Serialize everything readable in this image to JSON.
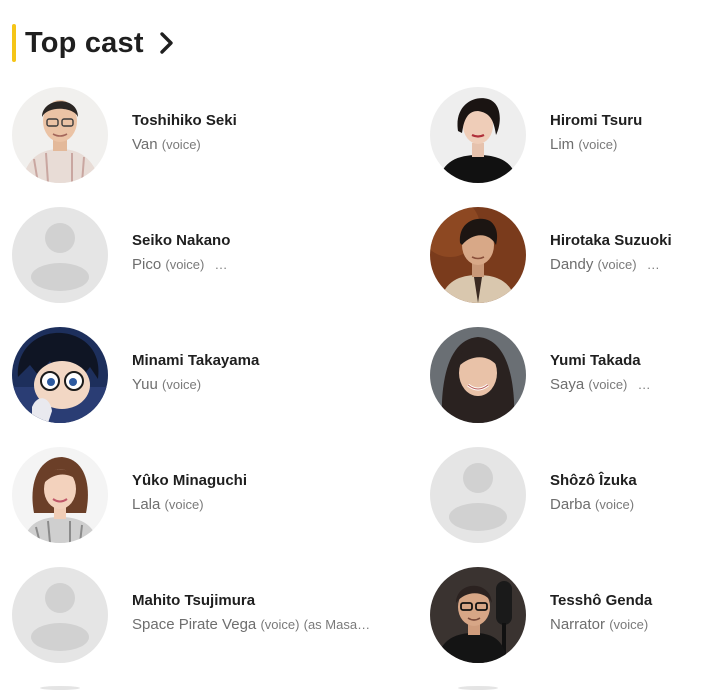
{
  "header": {
    "title": "Top cast",
    "accent_color": "#f5c518"
  },
  "cast": [
    {
      "name": "Toshihiko Seki",
      "character": "Van",
      "tag": "(voice)",
      "extra": "",
      "more": false,
      "photo": "man-glasses-shirt"
    },
    {
      "name": "Hiromi Tsuru",
      "character": "Lim",
      "tag": "(voice)",
      "extra": "",
      "more": false,
      "photo": "woman-short-hair"
    },
    {
      "name": "Seiko Nakano",
      "character": "Pico",
      "tag": "(voice)",
      "extra": "",
      "more": true,
      "photo": "placeholder"
    },
    {
      "name": "Hirotaka Suzuoki",
      "character": "Dandy",
      "tag": "(voice)",
      "extra": "",
      "more": true,
      "photo": "man-brown-background"
    },
    {
      "name": "Minami Takayama",
      "character": "Yuu",
      "tag": "(voice)",
      "extra": "",
      "more": false,
      "photo": "anime-boy-glasses"
    },
    {
      "name": "Yumi Takada",
      "character": "Saya",
      "tag": "(voice)",
      "extra": "",
      "more": true,
      "photo": "woman-long-hair"
    },
    {
      "name": "Yûko Minaguchi",
      "character": "Lala",
      "tag": "(voice)",
      "extra": "",
      "more": false,
      "photo": "woman-brown-hair"
    },
    {
      "name": "Shôzô Îzuka",
      "character": "Darba",
      "tag": "(voice)",
      "extra": "",
      "more": false,
      "photo": "placeholder"
    },
    {
      "name": "Mahito Tsujimura",
      "character": "Space Pirate Vega",
      "tag": "(voice)",
      "extra": "(as Masa…",
      "more": false,
      "photo": "placeholder"
    },
    {
      "name": "Tesshô Genda",
      "character": "Narrator",
      "tag": "(voice)",
      "extra": "",
      "more": false,
      "photo": "man-glasses-microphone"
    }
  ]
}
